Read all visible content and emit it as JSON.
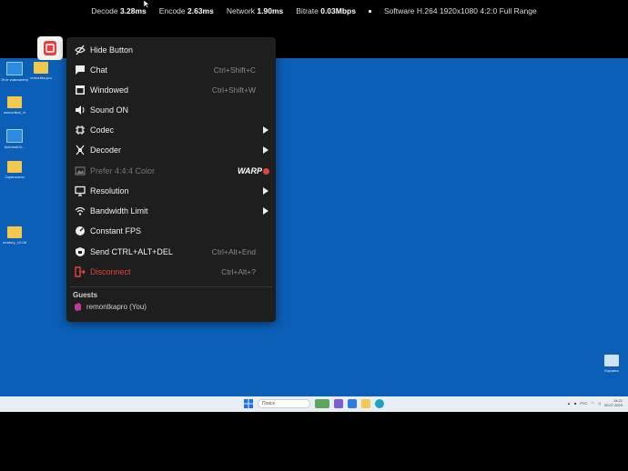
{
  "stats": {
    "decode_label": "Decode",
    "decode_value": "3.28ms",
    "encode_label": "Encode",
    "encode_value": "2.63ms",
    "network_label": "Network",
    "network_value": "1.90ms",
    "bitrate_label": "Bitrate",
    "bitrate_value": "0.03Mbps",
    "codec_info": "Software H.264 1920x1080 4:2:0 Full Range"
  },
  "desktop": {
    "icons": [
      {
        "label": "Этот компьютер",
        "icon": "monitor-icon"
      },
      {
        "label": "remontka.pro",
        "icon": "folder-icon"
      },
      {
        "label": "sssvonikal_vt",
        "icon": "folder-icon"
      },
      {
        "label": "Avtomat04...",
        "icon": "monitor-icon"
      },
      {
        "label": "Скриншоты",
        "icon": "folder-icon"
      },
      {
        "label": "remtory_10.08",
        "icon": "folder-icon"
      },
      {
        "label": "Корзина",
        "icon": "recycle-bin-icon"
      }
    ]
  },
  "taskbar": {
    "search_placeholder": "Поиск",
    "lang": "РУС",
    "time": "14:21",
    "date": "09.07.2023"
  },
  "menu": {
    "items": [
      {
        "label": "Hide Button",
        "shortcut": "",
        "icon": "eye-slash-icon"
      },
      {
        "label": "Chat",
        "shortcut": "Ctrl+Shift+C",
        "icon": "chat-icon"
      },
      {
        "label": "Windowed",
        "shortcut": "Ctrl+Shift+W",
        "icon": "window-icon"
      },
      {
        "label": "Sound ON",
        "shortcut": "",
        "icon": "speaker-icon"
      },
      {
        "label": "Codec",
        "shortcut": "",
        "icon": "chip-icon"
      },
      {
        "label": "Decoder",
        "shortcut": "",
        "icon": "decoder-icon"
      },
      {
        "label": "Prefer 4:4:4 Color",
        "shortcut": "",
        "icon": "image-icon",
        "badge": "WARP"
      },
      {
        "label": "Resolution",
        "shortcut": "",
        "icon": "monitor-icon"
      },
      {
        "label": "Bandwidth Limit",
        "shortcut": "",
        "icon": "wifi-icon"
      },
      {
        "label": "Constant FPS",
        "shortcut": "",
        "icon": "speedometer-icon"
      },
      {
        "label": "Send CTRL+ALT+DEL",
        "shortcut": "Ctrl+Alt+End",
        "icon": "lock-icon"
      },
      {
        "label": "Disconnect",
        "shortcut": "Ctrl+Alt+?",
        "icon": "disconnect-icon"
      }
    ],
    "guests_heading": "Guests",
    "guest_name": "remontkapro (You)"
  },
  "colors": {
    "menu_bg": "#1e1e1e",
    "desktop_blue": "#0b5fb6",
    "danger": "#e0443e"
  }
}
